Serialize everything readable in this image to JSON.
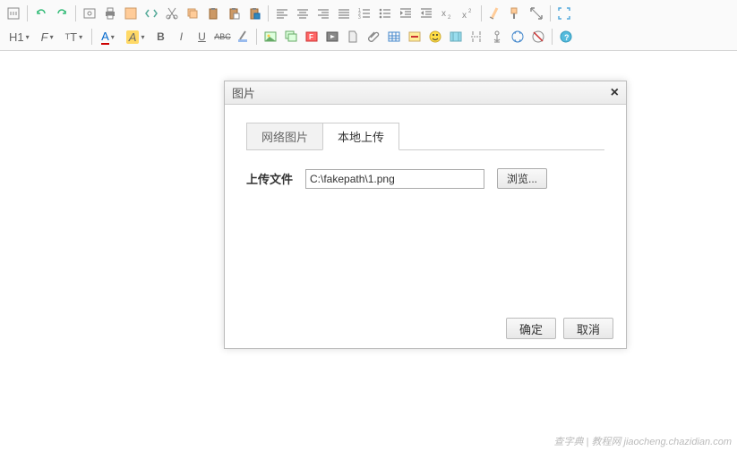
{
  "toolbar": {
    "row1": {
      "heading_dropdown": "H1",
      "font_family": "F",
      "font_size": "T"
    },
    "row2": {
      "text_color_letter": "A",
      "bg_color_letter": "A",
      "bold": "B",
      "italic": "I",
      "underline": "U",
      "strike": "ABC"
    }
  },
  "dialog": {
    "title": "图片",
    "tabs": {
      "network": "网络图片",
      "local": "本地上传"
    },
    "upload_label": "上传文件",
    "file_value": "C:\\fakepath\\1.png",
    "browse": "浏览...",
    "ok": "确定",
    "cancel": "取消"
  },
  "watermark": "查字典 | 教程网  jiaocheng.chazidian.com"
}
